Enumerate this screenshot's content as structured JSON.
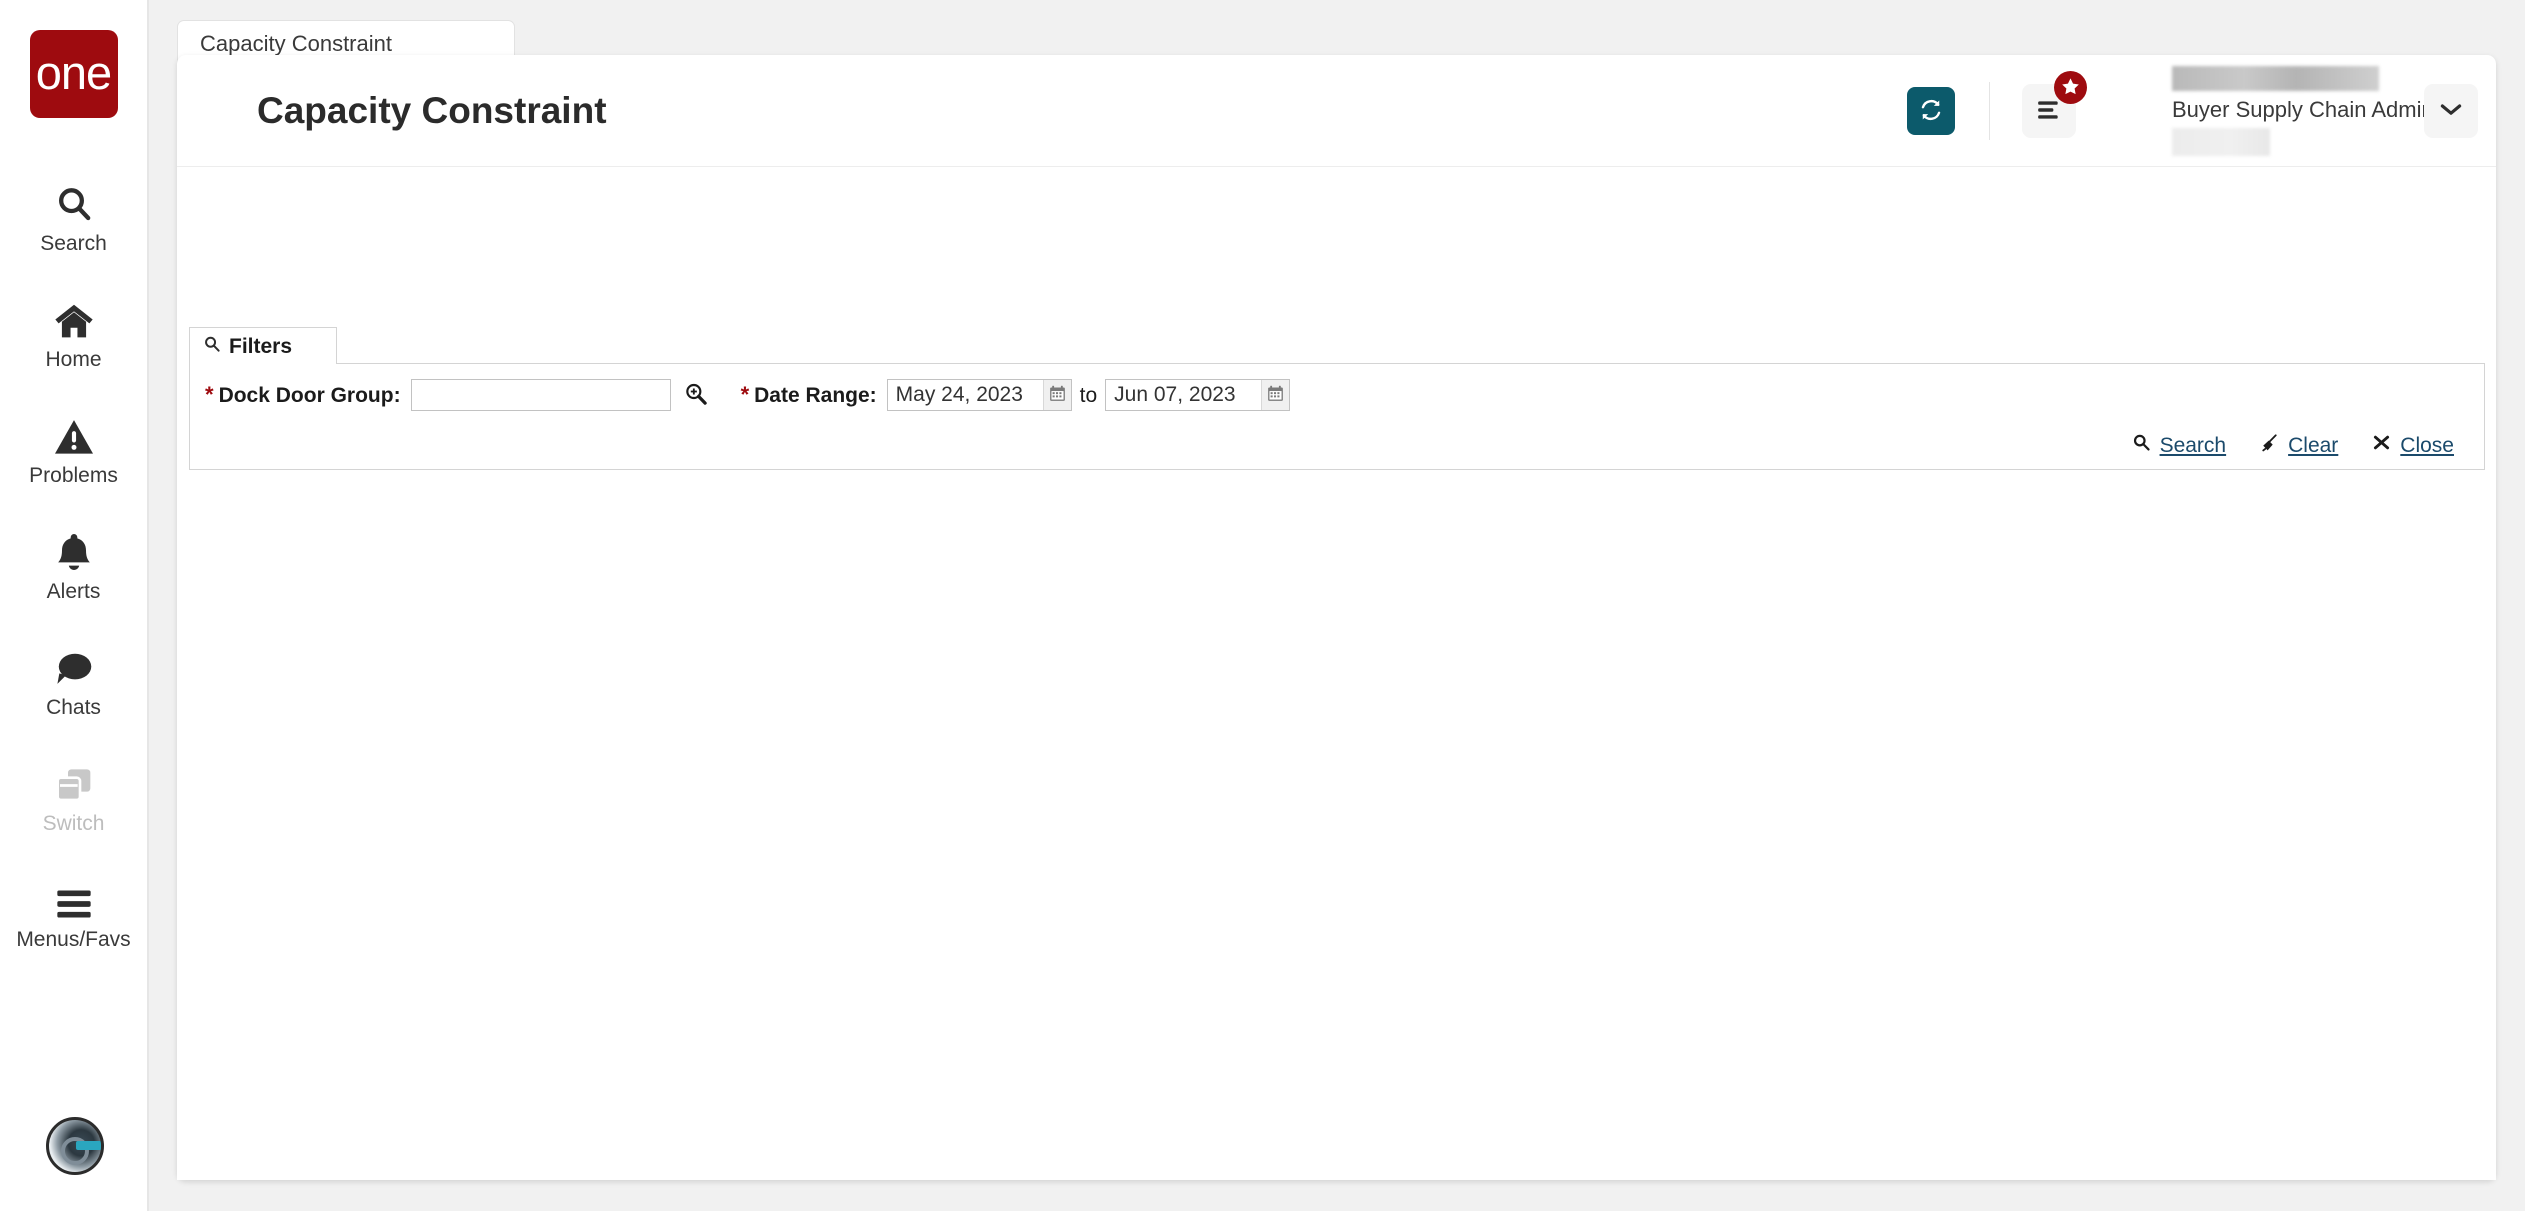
{
  "brand": {
    "logo_text": "one",
    "logo_color": "#9e0b0f"
  },
  "sidebar": {
    "items": [
      {
        "label": "Search",
        "icon": "search-icon",
        "disabled": false
      },
      {
        "label": "Home",
        "icon": "home-icon",
        "disabled": false
      },
      {
        "label": "Problems",
        "icon": "warning-triangle-icon",
        "disabled": false
      },
      {
        "label": "Alerts",
        "icon": "bell-icon",
        "disabled": false
      },
      {
        "label": "Chats",
        "icon": "chat-bubble-icon",
        "disabled": false
      },
      {
        "label": "Switch",
        "icon": "switch-windows-icon",
        "disabled": true
      },
      {
        "label": "Menus/Favs",
        "icon": "hamburger-icon",
        "disabled": false
      }
    ],
    "avatar_alt": "user-avatar"
  },
  "tabstrip": {
    "tabs": [
      {
        "label": "Capacity Constraint",
        "active": true
      }
    ],
    "active_underline_color": "#0e5c69"
  },
  "header": {
    "title": "Capacity Constraint",
    "refresh_icon": "refresh-icon",
    "refresh_color": "#0c5a6b",
    "menu_icon": "menu-lines-icon",
    "badge_icon": "star-icon",
    "badge_color": "#9e0b0f",
    "user_role": "Buyer Supply Chain Admin",
    "chevron_icon": "chevron-down-icon"
  },
  "filters": {
    "tab_label": "Filters",
    "tab_icon": "search-icon",
    "required_marker": "*",
    "dock_door_group": {
      "label": "Dock Door Group:",
      "value": "",
      "placeholder": "",
      "lookup_icon": "magnifier-plus-icon"
    },
    "date_range": {
      "label": "Date Range:",
      "from_value": "May 24, 2023",
      "to_word": "to",
      "to_value": "Jun 07, 2023",
      "calendar_icon": "calendar-icon"
    },
    "actions": [
      {
        "label": "Search",
        "icon": "search-icon"
      },
      {
        "label": "Clear",
        "icon": "broom-icon"
      },
      {
        "label": "Close",
        "icon": "close-x-icon"
      }
    ]
  }
}
